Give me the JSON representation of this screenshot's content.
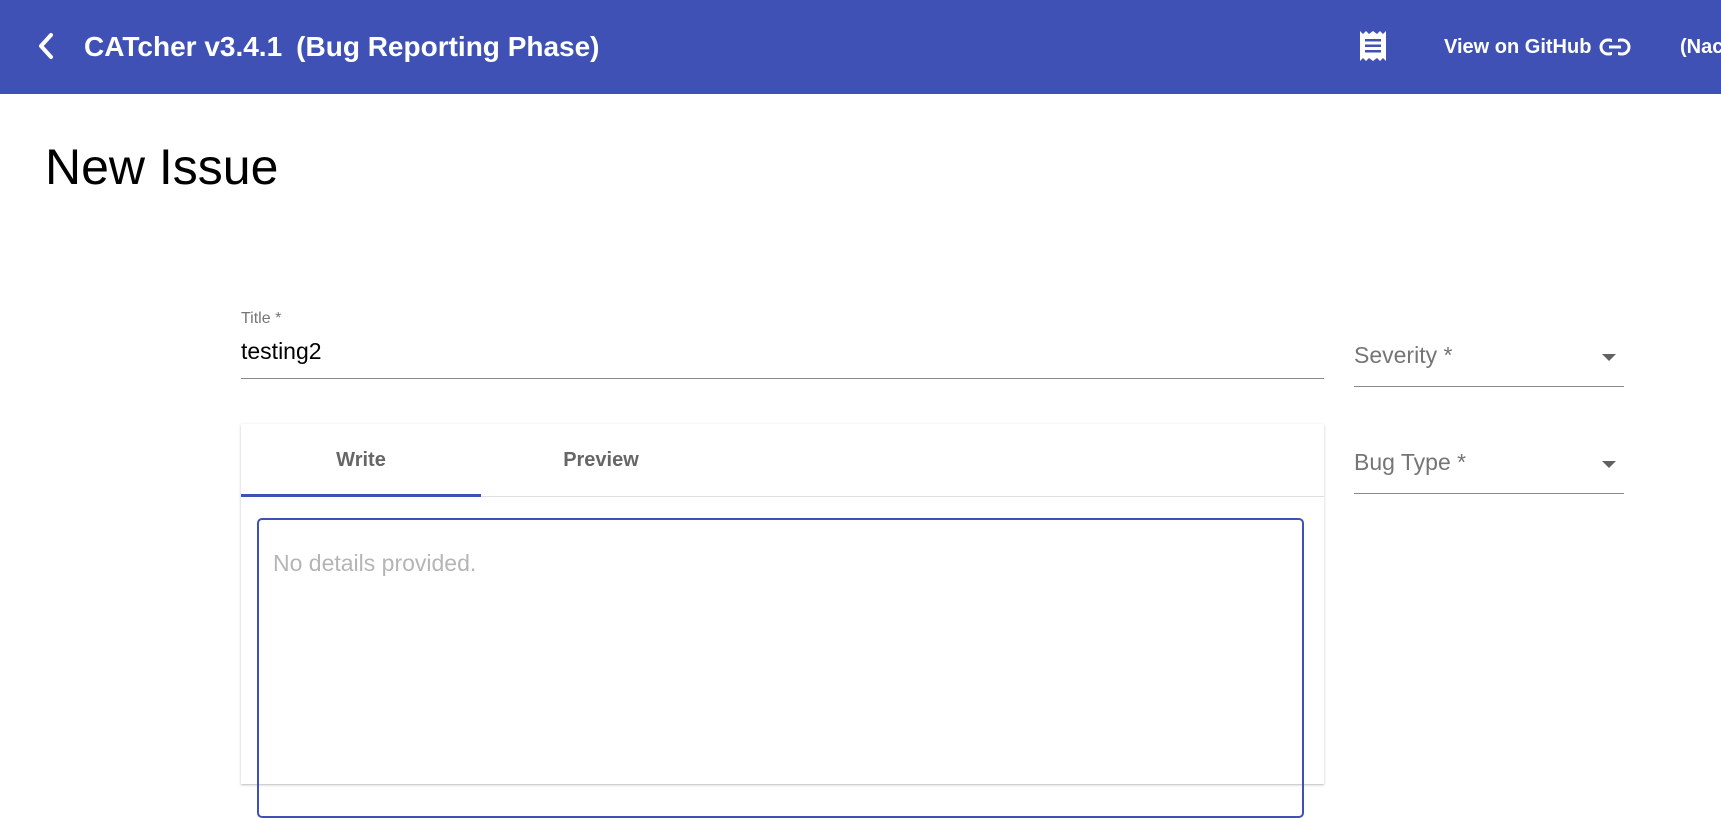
{
  "header": {
    "app_name": "CATcher v3.4.1",
    "phase": "(Bug Reporting Phase)",
    "github_link_label": "View on GitHub",
    "user_text": "(Nac",
    "back_icon": "chevron-left-icon",
    "log_icon": "receipt-icon",
    "link_icon": "link-icon",
    "color": "#3f51b5"
  },
  "page": {
    "title": "New Issue"
  },
  "form": {
    "title_label": "Title *",
    "title_value": "testing2",
    "severity_label": "Severity *",
    "bug_type_label": "Bug Type *",
    "tabs": [
      {
        "label": "Write",
        "active": true
      },
      {
        "label": "Preview",
        "active": false
      }
    ],
    "description_placeholder": "No details provided.",
    "description_value": ""
  }
}
